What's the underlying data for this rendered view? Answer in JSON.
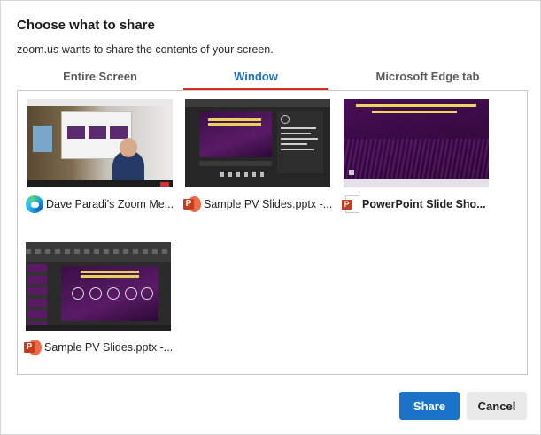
{
  "dialog": {
    "title": "Choose what to share",
    "subtitle": "zoom.us wants to share the contents of your screen."
  },
  "tabs": [
    {
      "label": "Entire Screen",
      "active": false
    },
    {
      "label": "Window",
      "active": true
    },
    {
      "label": "Microsoft Edge tab",
      "active": false
    }
  ],
  "windows": [
    {
      "label": "Dave Paradi's Zoom Me...",
      "icon": "edge-icon",
      "bold": false
    },
    {
      "label": "Sample PV Slides.pptx -...",
      "icon": "powerpoint-icon",
      "bold": false
    },
    {
      "label": "PowerPoint Slide Sho...",
      "icon": "powerpoint-slideshow-icon",
      "bold": true
    },
    {
      "label": "Sample PV Slides.pptx -...",
      "icon": "powerpoint-icon",
      "bold": false
    }
  ],
  "buttons": {
    "share": "Share",
    "cancel": "Cancel"
  },
  "colors": {
    "accent": "#1a73c8",
    "tab_underline": "#d93025"
  }
}
